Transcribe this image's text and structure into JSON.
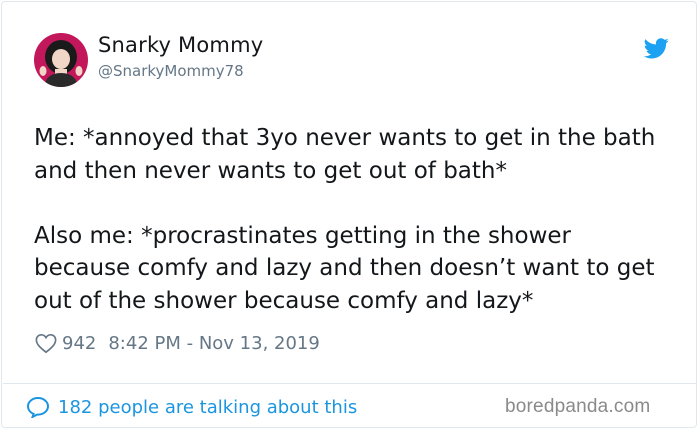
{
  "tweet": {
    "display_name": "Snarky Mommy",
    "handle": "@SnarkyMommy78",
    "text": "Me: *annoyed that 3yo never wants to get in the bath and then never wants to get out of bath*\n\nAlso me: *procrastinates getting in the shower because comfy and lazy and then doesn’t want to get out of the shower because comfy and lazy*",
    "likes": "942",
    "timestamp": "8:42 PM - Nov 13, 2019",
    "talking_link": "182 people are talking about this"
  },
  "icons": {
    "avatar": "avatar-photo",
    "logo": "twitter-bird-icon",
    "like": "heart-icon",
    "reply": "speech-bubble-icon"
  },
  "colors": {
    "accent": "#1da1f2",
    "link": "#1b95e0",
    "muted": "#657786",
    "text": "#14171a"
  },
  "watermark": "boredpanda.com"
}
